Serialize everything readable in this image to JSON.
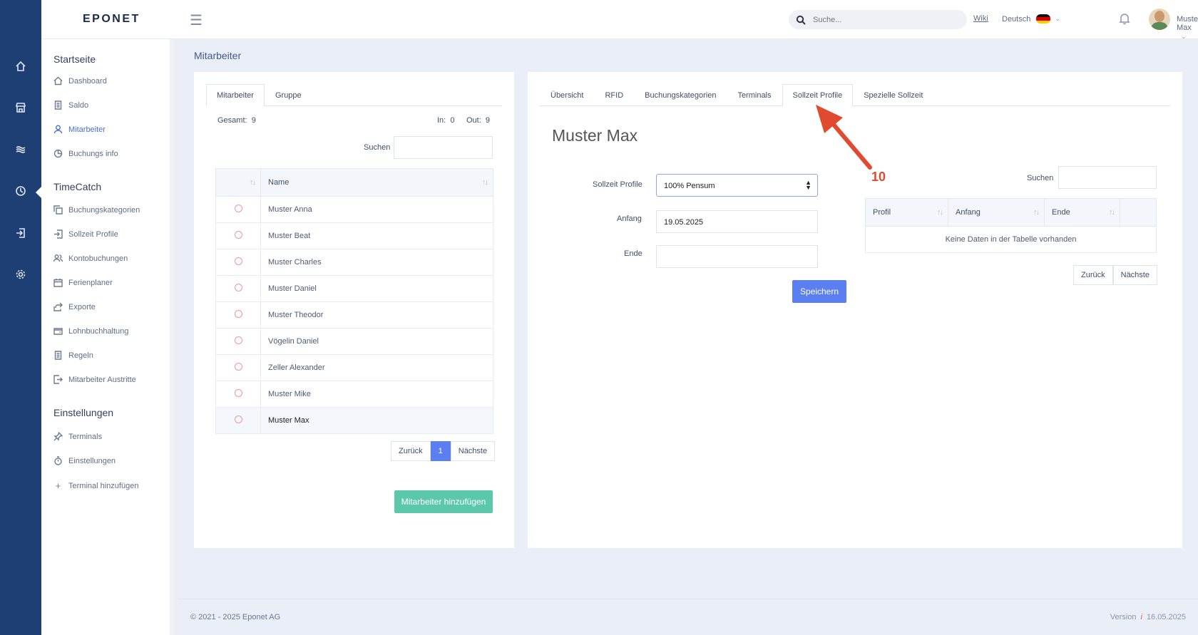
{
  "app": {
    "logo": "EPONET"
  },
  "topbar": {
    "search_placeholder": "Suche...",
    "wiki": "Wiki",
    "language": "Deutsch",
    "user": "Muster Max"
  },
  "sidebar": {
    "section1": "Startseite",
    "items1": [
      "Dashboard",
      "Saldo",
      "Mitarbeiter",
      "Buchungs info"
    ],
    "section2": "TimeCatch",
    "items2": [
      "Buchungskategorien",
      "Sollzeit Profile",
      "Kontobuchungen",
      "Ferienplaner",
      "Exporte",
      "Lohnbuchhaltung",
      "Regeln",
      "Mitarbeiter Austritte"
    ],
    "section3": "Einstellungen",
    "items3": [
      "Terminals",
      "Einstellungen",
      "Terminal hinzufügen"
    ]
  },
  "page": {
    "title": "Mitarbeiter"
  },
  "left": {
    "tabs": [
      "Mitarbeiter",
      "Gruppe"
    ],
    "total_label": "Gesamt:",
    "total": "9",
    "in_label": "In:",
    "in": "0",
    "out_label": "Out:",
    "out": "9",
    "search_label": "Suchen",
    "col_name": "Name",
    "rows": [
      "Muster Anna",
      "Muster Beat",
      "Muster Charles",
      "Muster Daniel",
      "Muster Theodor",
      "Vögelin Daniel",
      "Zeller Alexander",
      "Muster Mike",
      "Muster Max"
    ],
    "pager": {
      "prev": "Zurück",
      "page": "1",
      "next": "Nächste"
    },
    "add_button": "Mitarbeiter hinzufügen"
  },
  "right": {
    "tabs": [
      "Übersicht",
      "RFID",
      "Buchungskategorien",
      "Terminals",
      "Sollzeit Profile",
      "Spezielle Sollzeit"
    ],
    "employee": "Muster Max",
    "form": {
      "profile_label": "Sollzeit Profile",
      "profile_value": "100% Pensum",
      "start_label": "Anfang",
      "start_value": "19.05.2025",
      "end_label": "Ende",
      "end_value": "",
      "save": "Speichern"
    },
    "table": {
      "search_label": "Suchen",
      "cols": [
        "Profil",
        "Anfang",
        "Ende"
      ],
      "empty": "Keine Daten in der Tabelle vorhanden",
      "prev": "Zurück",
      "next": "Nächste"
    }
  },
  "annotation": {
    "number": "10",
    "color": "#e04a2f"
  },
  "footer": {
    "copyright": "© 2021 - 2025 Eponet AG",
    "version_label": "Version",
    "version_icon": "i",
    "version_date": "16.05.2025"
  },
  "colors": {
    "primary": "#5b7ef0",
    "success": "#5bc8ac",
    "rail": "#1e3f73"
  }
}
